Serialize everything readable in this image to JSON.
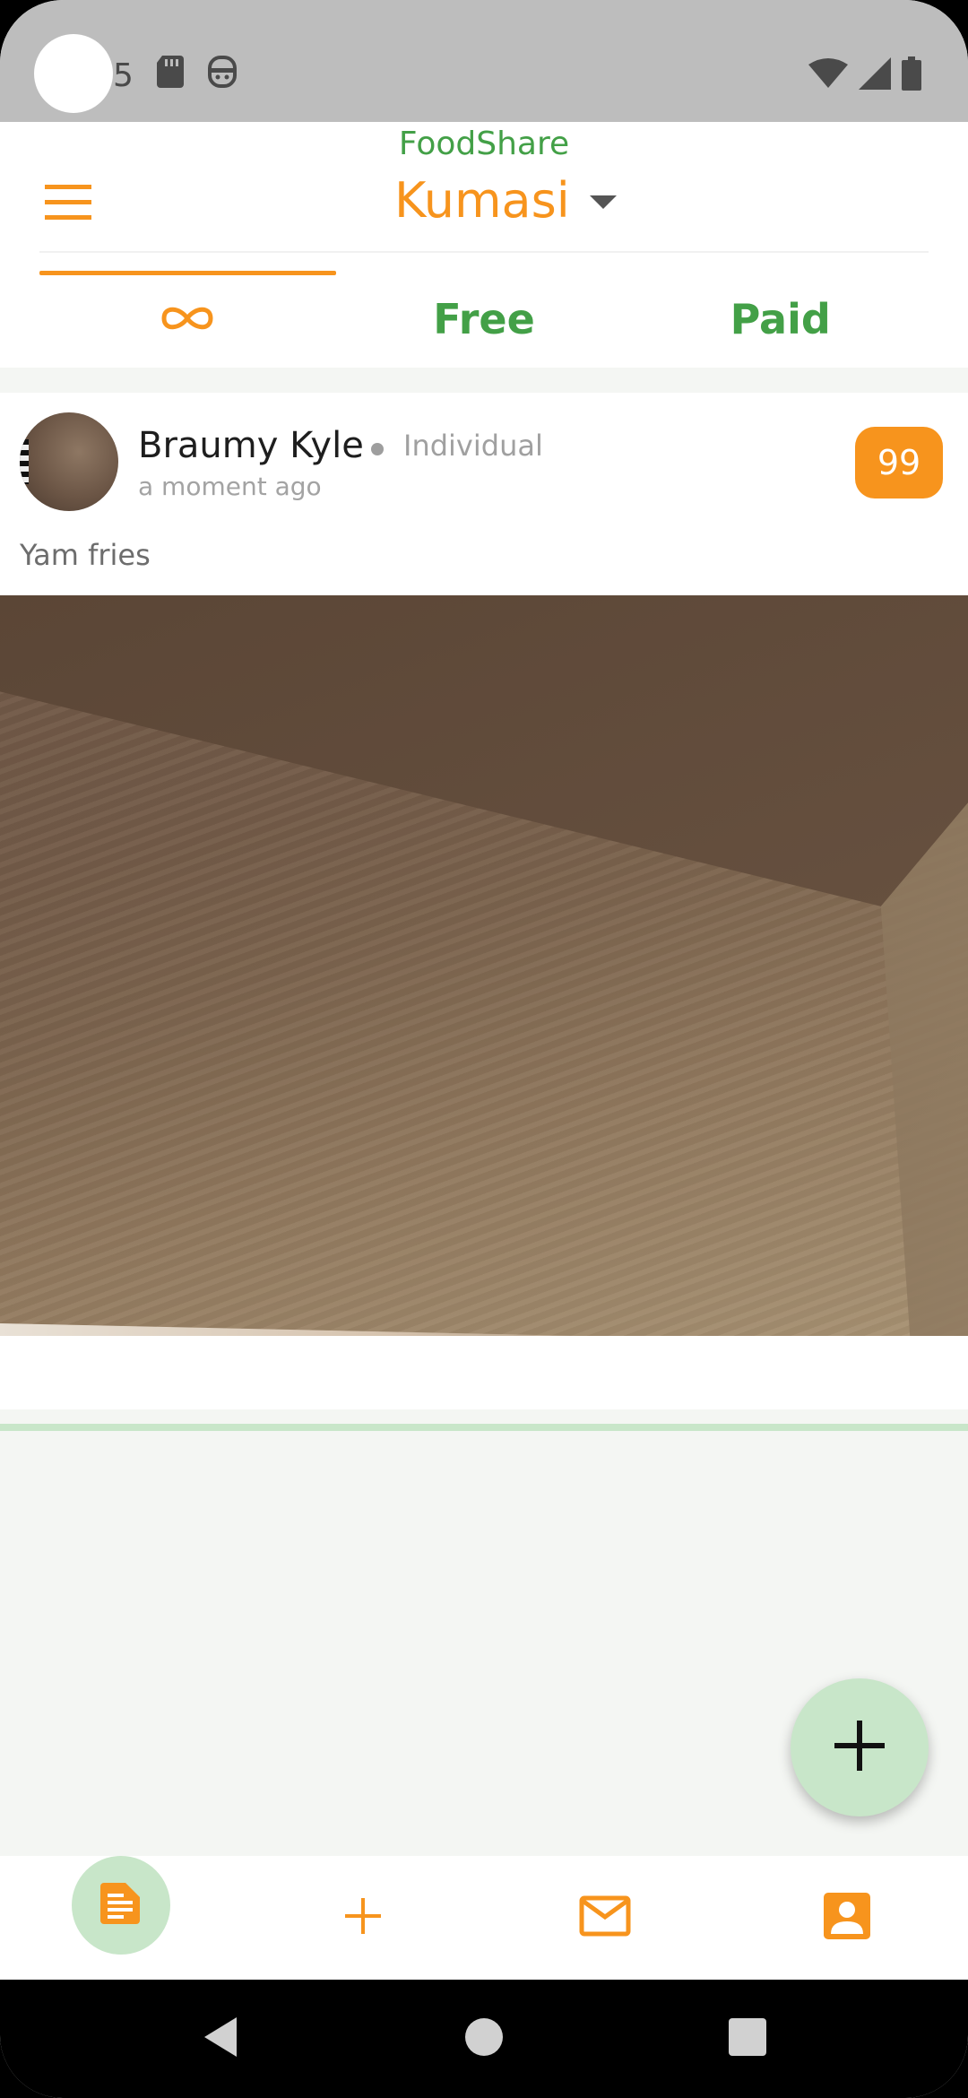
{
  "status_bar": {
    "time_partial": "5",
    "icons": [
      "sd-card-icon",
      "notification-app-icon",
      "wifi-icon",
      "cell-signal-icon",
      "battery-icon"
    ]
  },
  "header": {
    "app_name": "FoodShare",
    "city": "Kumasi",
    "menu_icon": "hamburger-menu-icon"
  },
  "tabs": [
    {
      "id": "all",
      "label": "",
      "icon": "infinity-icon",
      "active": true
    },
    {
      "id": "free",
      "label": "Free",
      "active": false
    },
    {
      "id": "paid",
      "label": "Paid",
      "active": false
    }
  ],
  "post": {
    "poster_name": "Braumy Kyle",
    "poster_type": "Individual",
    "time_ago": "a moment ago",
    "count": "99",
    "title": "Yam fries"
  },
  "fab": {
    "icon": "plus-icon"
  },
  "bottom_nav": [
    {
      "id": "posts",
      "icon": "document-icon",
      "active": true
    },
    {
      "id": "add",
      "icon": "plus-icon",
      "active": false
    },
    {
      "id": "messages",
      "icon": "mail-icon",
      "active": false
    },
    {
      "id": "profile",
      "icon": "account-box-icon",
      "active": false
    }
  ],
  "colors": {
    "accent_orange": "#f7941d",
    "brand_green": "#43a047",
    "light_green": "#c8e6c9",
    "background": "#f4f6f3"
  }
}
